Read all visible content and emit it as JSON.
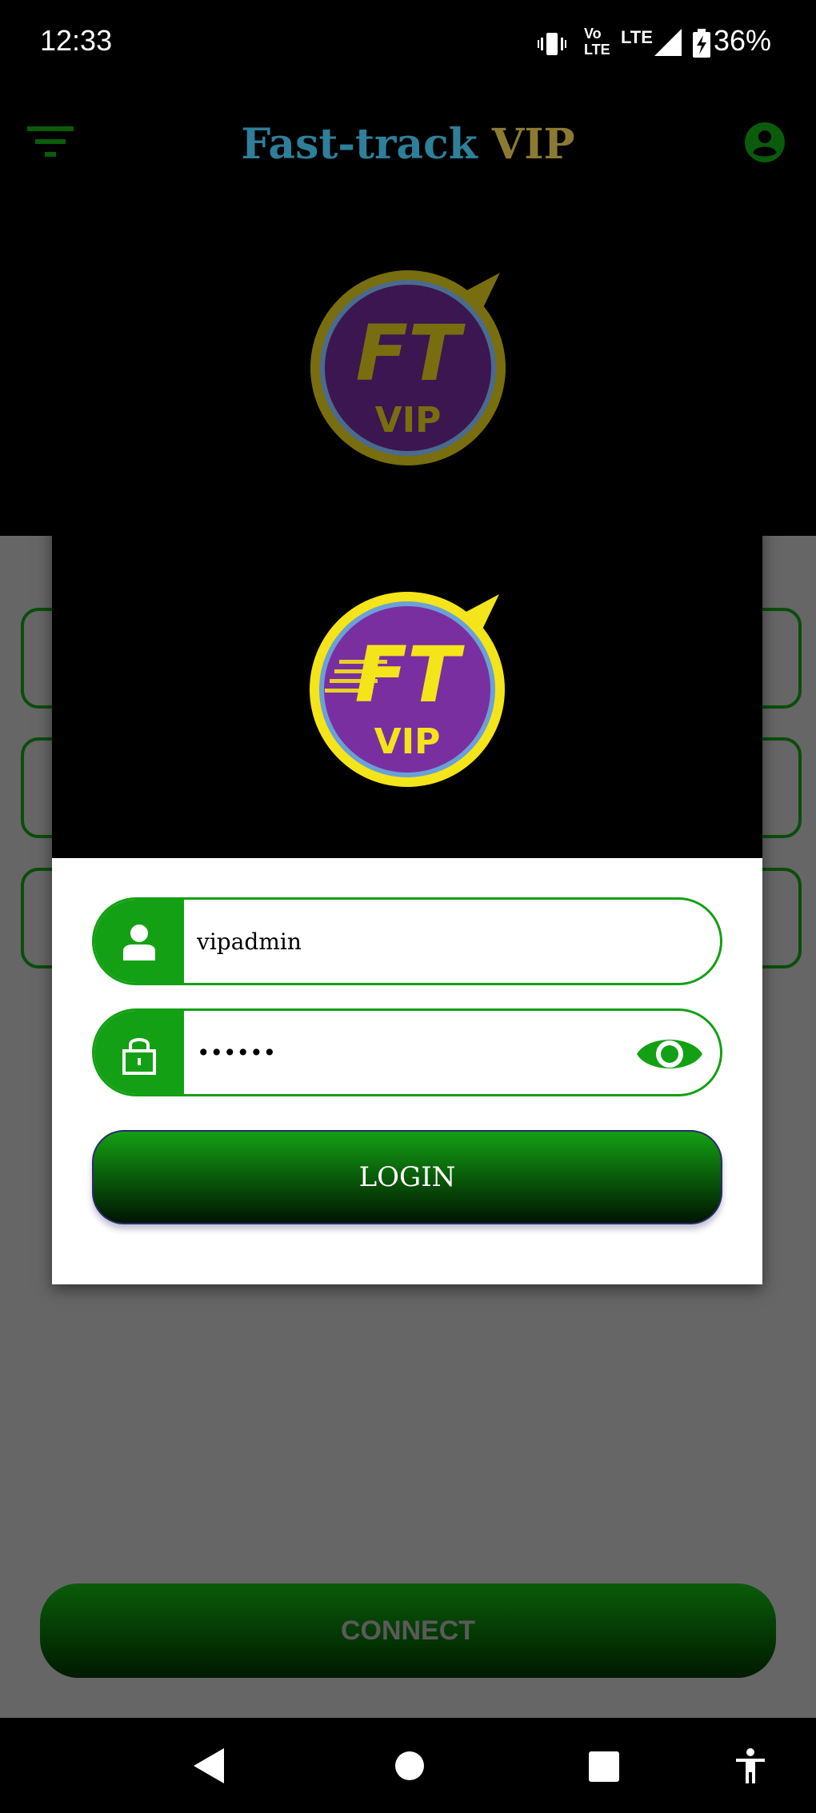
{
  "status_bar": {
    "time": "12:33",
    "volte_top": "Vo",
    "volte_bottom": "LTE",
    "network": "LTE",
    "battery": "36%"
  },
  "app_bar": {
    "title_part1": "Fast-track",
    "title_part2": "VIP",
    "title_part1_color": "#2e7f99",
    "title_part2_color": "#8a7a33",
    "left_icon": "filter-icon",
    "right_icon": "account-icon"
  },
  "logo": {
    "top_text": "FT",
    "bottom_text": "VIP"
  },
  "login_form": {
    "username_value": "vipadmin",
    "password_value": "••••••",
    "login_label": "LOGIN"
  },
  "connect_label": "CONNECT",
  "colors": {
    "accent_green": "#14a014",
    "logo_yellow": "#f4e41a",
    "logo_purple": "#7a2fa0"
  }
}
